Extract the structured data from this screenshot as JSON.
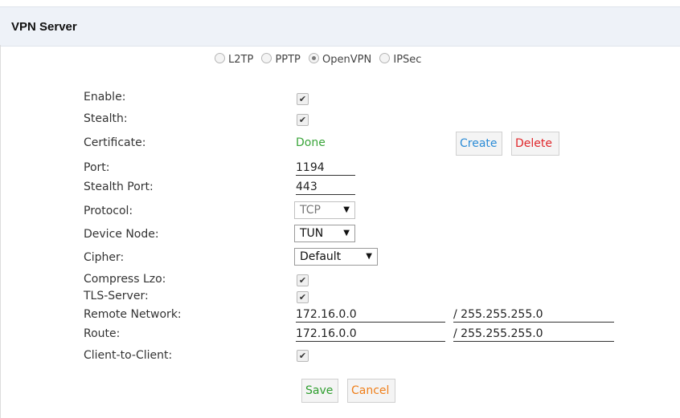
{
  "panel": {
    "title": "VPN Server"
  },
  "vpn_types": [
    {
      "label": "L2TP",
      "selected": false
    },
    {
      "label": "PPTP",
      "selected": false
    },
    {
      "label": "OpenVPN",
      "selected": true
    },
    {
      "label": "IPSec",
      "selected": false
    }
  ],
  "form": {
    "enable": {
      "label": "Enable:",
      "checked": true
    },
    "stealth": {
      "label": "Stealth:",
      "checked": true
    },
    "certificate": {
      "label": "Certificate:",
      "status": "Done",
      "create_label": "Create",
      "delete_label": "Delete"
    },
    "port": {
      "label": "Port:",
      "value": "1194"
    },
    "stealth_port": {
      "label": "Stealth Port:",
      "value": "443"
    },
    "protocol": {
      "label": "Protocol:",
      "value": "TCP"
    },
    "device_node": {
      "label": "Device Node:",
      "value": "TUN"
    },
    "cipher": {
      "label": "Cipher:",
      "value": "Default"
    },
    "compress_lzo": {
      "label": "Compress Lzo:",
      "checked": true
    },
    "tls_server": {
      "label": "TLS-Server:",
      "checked": true
    },
    "remote_network": {
      "label": "Remote Network:",
      "ip": "172.16.0.0",
      "mask": "/ 255.255.255.0"
    },
    "route": {
      "label": "Route:",
      "ip": "172.16.0.0",
      "mask": "/ 255.255.255.0"
    },
    "client_to_client": {
      "label": "Client-to-Client:",
      "checked": true
    }
  },
  "actions": {
    "save_label": "Save",
    "cancel_label": "Cancel"
  },
  "colors": {
    "header_bg": "#eef2f8",
    "done": "#3aa53a",
    "create": "#2a8bd6",
    "delete": "#e0262a",
    "save": "#2f9e2f",
    "cancel": "#ef7f1a"
  },
  "icons": {
    "check": "✔",
    "dropdown": "▼"
  }
}
